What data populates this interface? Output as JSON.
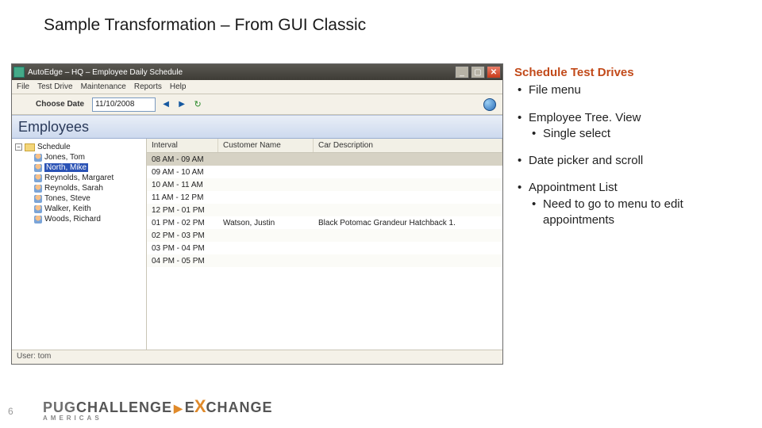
{
  "slide": {
    "title": "Sample Transformation – From GUI Classic",
    "page_number": "6"
  },
  "window": {
    "title": "AutoEdge – HQ – Employee Daily Schedule",
    "menu": [
      "File",
      "Test Drive",
      "Maintenance",
      "Reports",
      "Help"
    ],
    "toolbar": {
      "date_label": "Choose Date",
      "date_value": "11/10/2008"
    },
    "section_title": "Employees",
    "tree": {
      "root_label": "Schedule",
      "items": [
        {
          "label": "Jones, Tom",
          "selected": false
        },
        {
          "label": "North, Mike",
          "selected": true
        },
        {
          "label": "Reynolds, Margaret",
          "selected": false
        },
        {
          "label": "Reynolds, Sarah",
          "selected": false
        },
        {
          "label": "Tones, Steve",
          "selected": false
        },
        {
          "label": "Walker, Keith",
          "selected": false
        },
        {
          "label": "Woods, Richard",
          "selected": false
        }
      ]
    },
    "grid": {
      "headers": [
        "Interval",
        "Customer Name",
        "Car Description"
      ],
      "rows": [
        {
          "interval": "08 AM - 09 AM",
          "customer": "",
          "car": "",
          "selected": true
        },
        {
          "interval": "09 AM - 10 AM",
          "customer": "",
          "car": ""
        },
        {
          "interval": "10 AM - 11 AM",
          "customer": "",
          "car": ""
        },
        {
          "interval": "11 AM - 12 PM",
          "customer": "",
          "car": ""
        },
        {
          "interval": "12 PM - 01 PM",
          "customer": "",
          "car": ""
        },
        {
          "interval": "01 PM - 02 PM",
          "customer": "Watson, Justin",
          "car": "Black Potomac Grandeur Hatchback 1."
        },
        {
          "interval": "02 PM - 03 PM",
          "customer": "",
          "car": ""
        },
        {
          "interval": "03 PM - 04 PM",
          "customer": "",
          "car": ""
        },
        {
          "interval": "04 PM - 05 PM",
          "customer": "",
          "car": ""
        }
      ]
    },
    "status": "User: tom"
  },
  "notes": {
    "heading": "Schedule Test Drives",
    "b1": "File menu",
    "b2": "Employee Tree. View",
    "b2a": "Single select",
    "b3": "Date picker and scroll",
    "b4": "Appointment List",
    "b4a": "Need to go to menu to edit appointments"
  },
  "footer": {
    "part1": "PUG",
    "part2": "CHALLENGE",
    "part3": "E",
    "part4": "X",
    "part5": "CHANGE",
    "sub": "AMERICAS"
  }
}
